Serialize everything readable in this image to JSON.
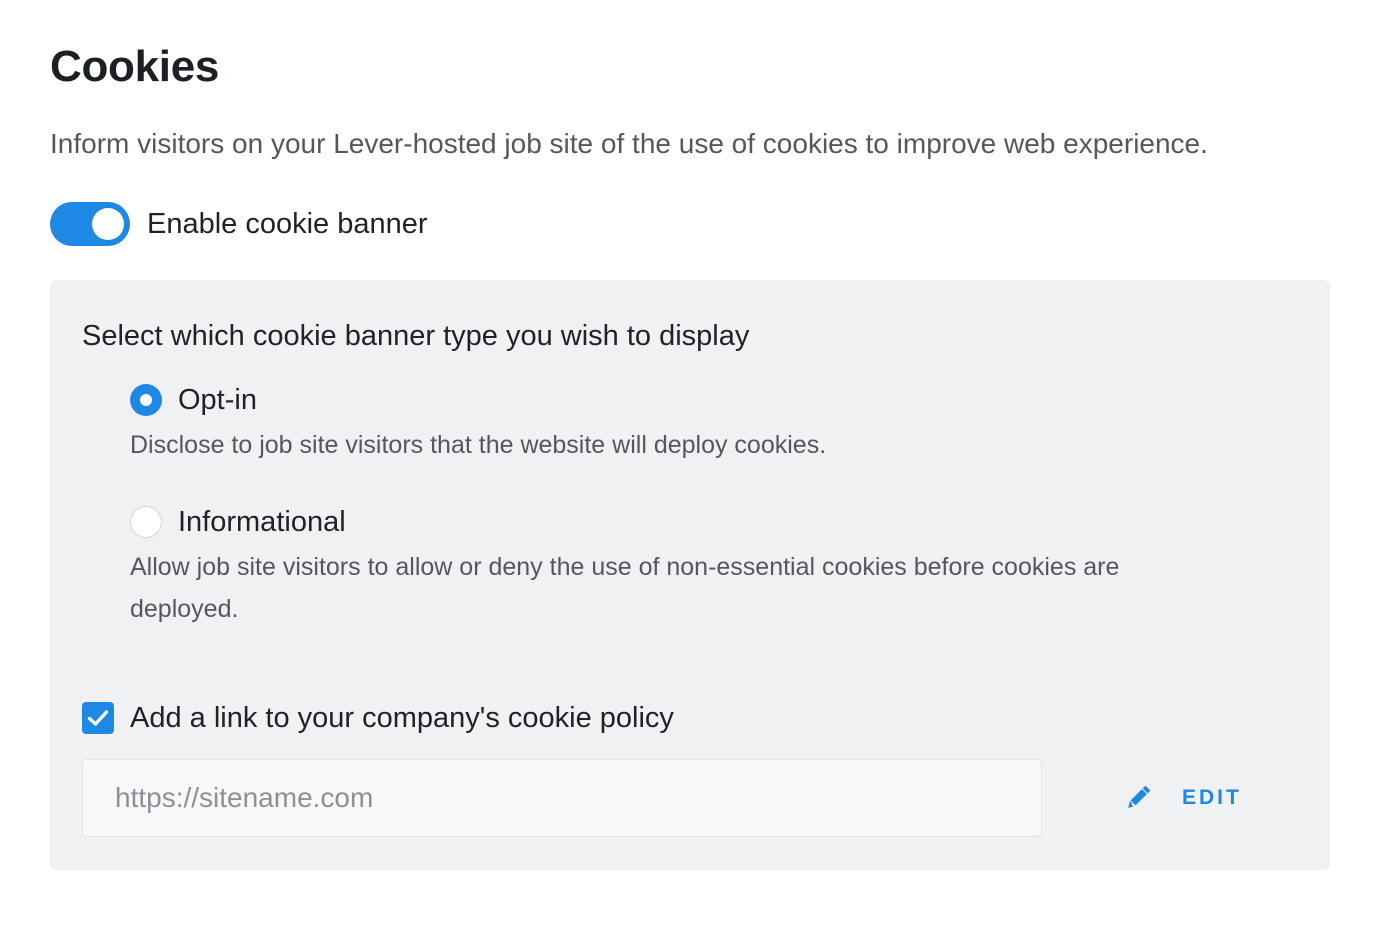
{
  "header": {
    "title": "Cookies",
    "description": "Inform visitors on your Lever-hosted job site of the use of cookies to improve web experience."
  },
  "toggle": {
    "label": "Enable cookie banner",
    "enabled": true
  },
  "panel": {
    "question": "Select which cookie banner type you wish to display",
    "options": [
      {
        "label": "Opt-in",
        "description": "Disclose to job site visitors that the website will deploy cookies.",
        "selected": true
      },
      {
        "label": "Informational",
        "description": "Allow job site visitors to allow or deny the use of non-essential cookies before cookies are deployed.",
        "selected": false
      }
    ],
    "policy_checkbox": {
      "label": "Add a link to your company's cookie policy",
      "checked": true
    },
    "url_input": {
      "placeholder": "https://sitename.com",
      "value": ""
    },
    "edit_button": {
      "label": "EDIT",
      "icon": "pencil-icon"
    }
  },
  "colors": {
    "accent": "#1e88e5",
    "panel_background": "#f0f1f3",
    "muted_text": "#54585e"
  }
}
